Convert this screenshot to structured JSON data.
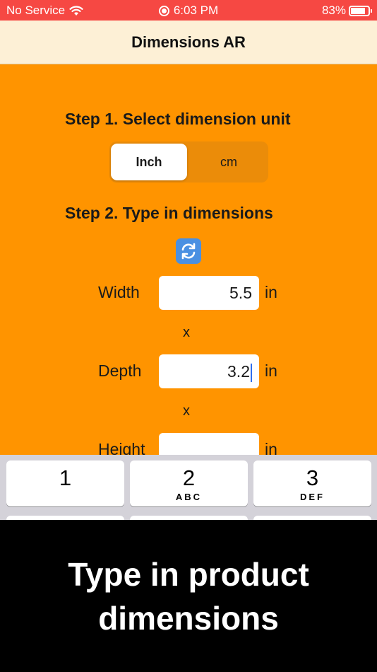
{
  "status_bar": {
    "carrier": "No Service",
    "time": "6:03 PM",
    "battery": "83%",
    "battery_level": 0.83
  },
  "nav": {
    "title": "Dimensions AR"
  },
  "step1": {
    "title": "Step 1. Select dimension unit",
    "options": [
      "Inch",
      "cm"
    ],
    "selected": "Inch"
  },
  "step2": {
    "title": "Step 2. Type in dimensions",
    "swap_icon": "swap-arrows-icon",
    "fields": [
      {
        "label": "Width",
        "value": "5.5",
        "unit": "in"
      },
      {
        "label": "Depth",
        "value": "3.2",
        "unit": "in"
      },
      {
        "label": "Height",
        "value": "",
        "unit": "in"
      }
    ],
    "separator": "x"
  },
  "keyboard": {
    "keys": [
      {
        "num": "1",
        "letters": ""
      },
      {
        "num": "2",
        "letters": "ABC"
      },
      {
        "num": "3",
        "letters": "DEF"
      }
    ]
  },
  "caption": {
    "text": "Type in product dimensions"
  },
  "colors": {
    "status_bar": "#f64843",
    "nav_bar": "#fdf0d6",
    "content": "#ff9400",
    "caption_bg": "#000000"
  }
}
